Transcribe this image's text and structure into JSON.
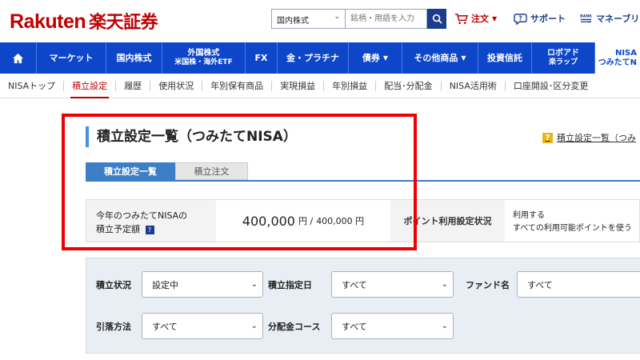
{
  "brand": {
    "logo_en": "Rakuten",
    "logo_jp": "楽天証券",
    "color": "#bf0000"
  },
  "search": {
    "category": "国内株式",
    "placeholder": "銘柄・用語を入力"
  },
  "top_links": {
    "order": "注文",
    "support": "サポート",
    "money": "マネーブリ"
  },
  "main_nav": [
    {
      "label": "マーケット"
    },
    {
      "label": "国内株式"
    },
    {
      "label": "外国株式",
      "sub": "米国株・海外ETF"
    },
    {
      "label": "FX"
    },
    {
      "label": "金・プラチナ"
    },
    {
      "label": "債券"
    },
    {
      "label": "その他商品"
    },
    {
      "label": "投資信託"
    },
    {
      "label": "ロボアド",
      "sub": "楽ラップ"
    },
    {
      "label": "NISA",
      "sub": "つみたてN"
    }
  ],
  "sub_nav": [
    "NISAトップ",
    "積立設定",
    "履歴",
    "使用状況",
    "年別保有商品",
    "実現損益",
    "年別損益",
    "配当･分配金",
    "NISA活用術",
    "口座開設･区分変更"
  ],
  "page": {
    "title": "積立設定一覧（つみたてNISA）",
    "help_link": "積立設定一覧（つみ"
  },
  "tabs": {
    "active": "積立設定一覧",
    "inactive": "積立注文"
  },
  "info": {
    "label_line1": "今年のつみたてNISAの",
    "label_line2": "積立予定額",
    "amount": "400,000",
    "unit": "円 /",
    "limit": "400,000 円",
    "points_label": "ポイント利用設定状況",
    "points_line1": "利用する",
    "points_line2": "すべての利用可能ポイントを使う"
  },
  "filters": {
    "status_label": "積立状況",
    "status_value": "設定中",
    "day_label": "積立指定日",
    "day_value": "すべて",
    "fund_label": "ファンド名",
    "fund_value": "すべて",
    "withdraw_label": "引落方法",
    "withdraw_value": "すべて",
    "dist_label": "分配金コース",
    "dist_value": "すべて"
  },
  "colors": {
    "nav_blue": "#0d46c9",
    "tab_blue": "#3c7fc7",
    "highlight": "#ee0000"
  }
}
